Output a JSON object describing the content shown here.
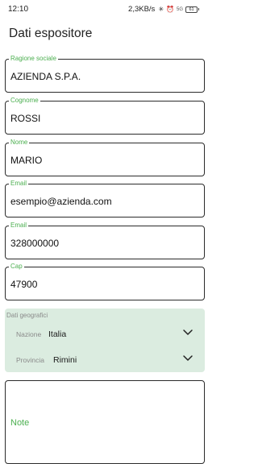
{
  "status_bar": {
    "time": "12:10",
    "network_speed": "2,3KB/s",
    "signal_text": "5G",
    "battery_level": "61"
  },
  "page": {
    "title": "Dati espositore"
  },
  "fields": {
    "ragione_sociale": {
      "label": "Ragione sociale",
      "value": "AZIENDA S.P.A."
    },
    "cognome": {
      "label": "Cognome",
      "value": "ROSSI"
    },
    "nome": {
      "label": "Nome",
      "value": "MARIO"
    },
    "email": {
      "label": "Email",
      "value": "esempio@azienda.com"
    },
    "telefono": {
      "label": "Email",
      "value": "328000000"
    },
    "cap": {
      "label": "Cap",
      "value": "47900"
    }
  },
  "geo": {
    "title": "Dati geografici",
    "nazione": {
      "label": "Nazione",
      "value": "Italia"
    },
    "provincia": {
      "label": "Provincia",
      "value": "Rimini"
    }
  },
  "notes": {
    "label": "Note"
  },
  "colors": {
    "accent": "#4caf50",
    "geo_bg": "#dbece0",
    "border": "#2b2b2b"
  }
}
